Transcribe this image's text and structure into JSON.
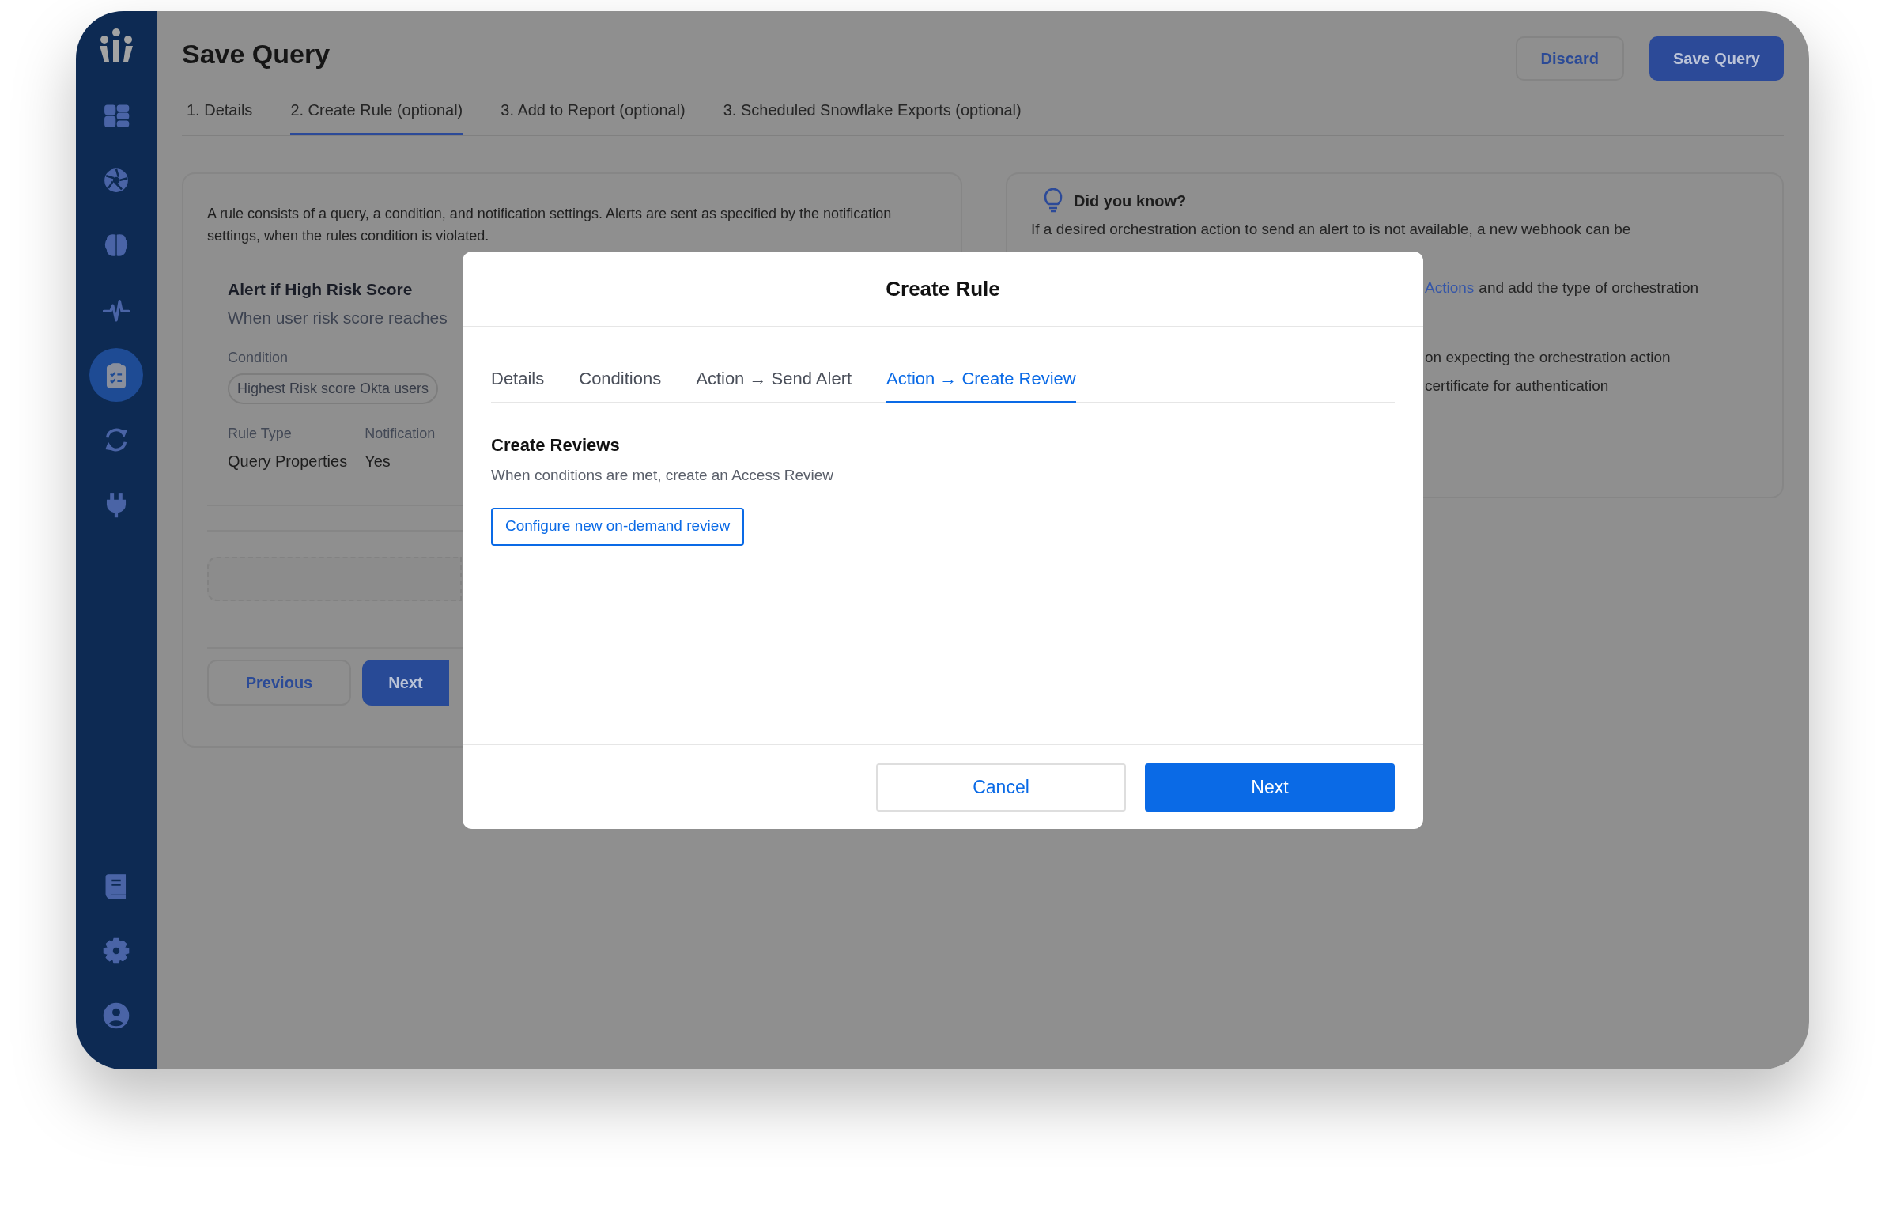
{
  "sidebar": {
    "items": [
      {
        "kind": "grid",
        "selected": false
      },
      {
        "kind": "aperture",
        "selected": false
      },
      {
        "kind": "brain",
        "selected": false
      },
      {
        "kind": "pulse",
        "selected": false
      },
      {
        "kind": "clipboard",
        "selected": true
      },
      {
        "kind": "sync",
        "selected": false
      },
      {
        "kind": "plug",
        "selected": false
      }
    ],
    "bottom_items": [
      {
        "kind": "book"
      },
      {
        "kind": "gear"
      },
      {
        "kind": "user"
      }
    ]
  },
  "header": {
    "title": "Save Query",
    "buttons": [
      {
        "label": "Discard",
        "kind": "secondary"
      },
      {
        "label": "Save Query",
        "kind": "primary"
      }
    ]
  },
  "steps": [
    {
      "label": "1. Details",
      "selected": false
    },
    {
      "label": "2. Create Rule (optional)",
      "selected": true
    },
    {
      "label": "3. Add to Report (optional)",
      "selected": false
    },
    {
      "label": "3. Scheduled Snowflake Exports (optional)",
      "selected": false
    }
  ],
  "rule_card": {
    "intro": "A rule consists of a query, a condition, and notification settings. Alerts are sent as specified by the notification settings, when the rules condition is violated.",
    "rule_title": "Alert if High Risk Score",
    "rule_description": "When user risk score reaches",
    "condition_label": "Condition",
    "condition_chip": "Highest Risk score Okta users",
    "fields": [
      {
        "label": "Rule Type",
        "value": "Query Properties"
      },
      {
        "label": "Notification",
        "value": "Yes"
      }
    ],
    "buttons": [
      {
        "label": "Previous",
        "kind": "secondary"
      },
      {
        "label": "Next",
        "kind": "primary"
      }
    ]
  },
  "tip_card": {
    "title": "Did you know?",
    "lines": [
      [
        {
          "kind": "text",
          "text": "If a desired orchestration action to send an alert to is not available, a new webhook can be"
        }
      ],
      [
        {
          "kind": "link",
          "text": "Actions"
        },
        {
          "kind": "text",
          "text": "and add the type of orchestration"
        }
      ],
      [
        {
          "kind": "text",
          "text": "on expecting the orchestration action"
        }
      ],
      [
        {
          "kind": "text",
          "text": "certificate for authentication"
        }
      ]
    ]
  },
  "modal": {
    "title": "Create Rule",
    "tabs": [
      {
        "label": "Details",
        "selected": false
      },
      {
        "label": "Conditions",
        "selected": false
      },
      {
        "label": "Action → Send Alert",
        "selected": false
      },
      {
        "label": "Action → Create Review",
        "selected": true
      }
    ],
    "section_title": "Create Reviews",
    "section_description": "When conditions are met, create an Access Review",
    "action_button": "Configure new on-demand review",
    "footer_buttons": [
      {
        "label": "Cancel",
        "kind": "secondary"
      },
      {
        "label": "Next",
        "kind": "primary"
      }
    ]
  }
}
